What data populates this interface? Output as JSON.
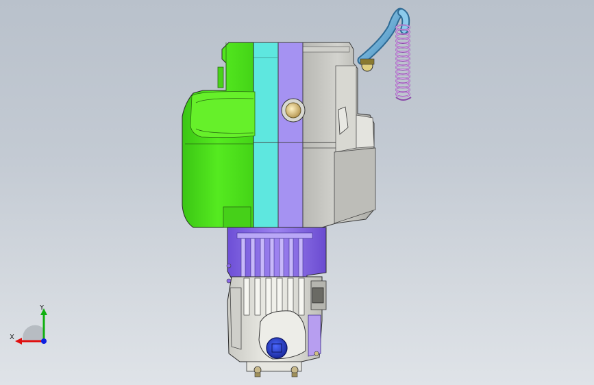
{
  "viewport": {
    "background_top": "#b9c1cb",
    "background_bottom": "#dfe3e8"
  },
  "model": {
    "name": "",
    "parts": [
      {
        "id": "left-cover",
        "color": "#4fe31b"
      },
      {
        "id": "cyan-section",
        "color": "#5ee7df"
      },
      {
        "id": "purple-section",
        "color": "#a592f2"
      },
      {
        "id": "crankcase",
        "color": "#c7c7c2"
      },
      {
        "id": "cylinder-block",
        "color": "#8b6be8"
      },
      {
        "id": "cylinder-head",
        "color": "#e0e0da"
      },
      {
        "id": "oil-plug",
        "color": "#2a3fc9"
      },
      {
        "id": "exhaust-pipe",
        "color": "#6fb9e0"
      },
      {
        "id": "spring",
        "color": "#c48fd6"
      }
    ]
  },
  "triad": {
    "x_label": "X",
    "y_label": "Y",
    "x_color": "#e01010",
    "y_color": "#10b010",
    "z_color": "#1020e0"
  }
}
